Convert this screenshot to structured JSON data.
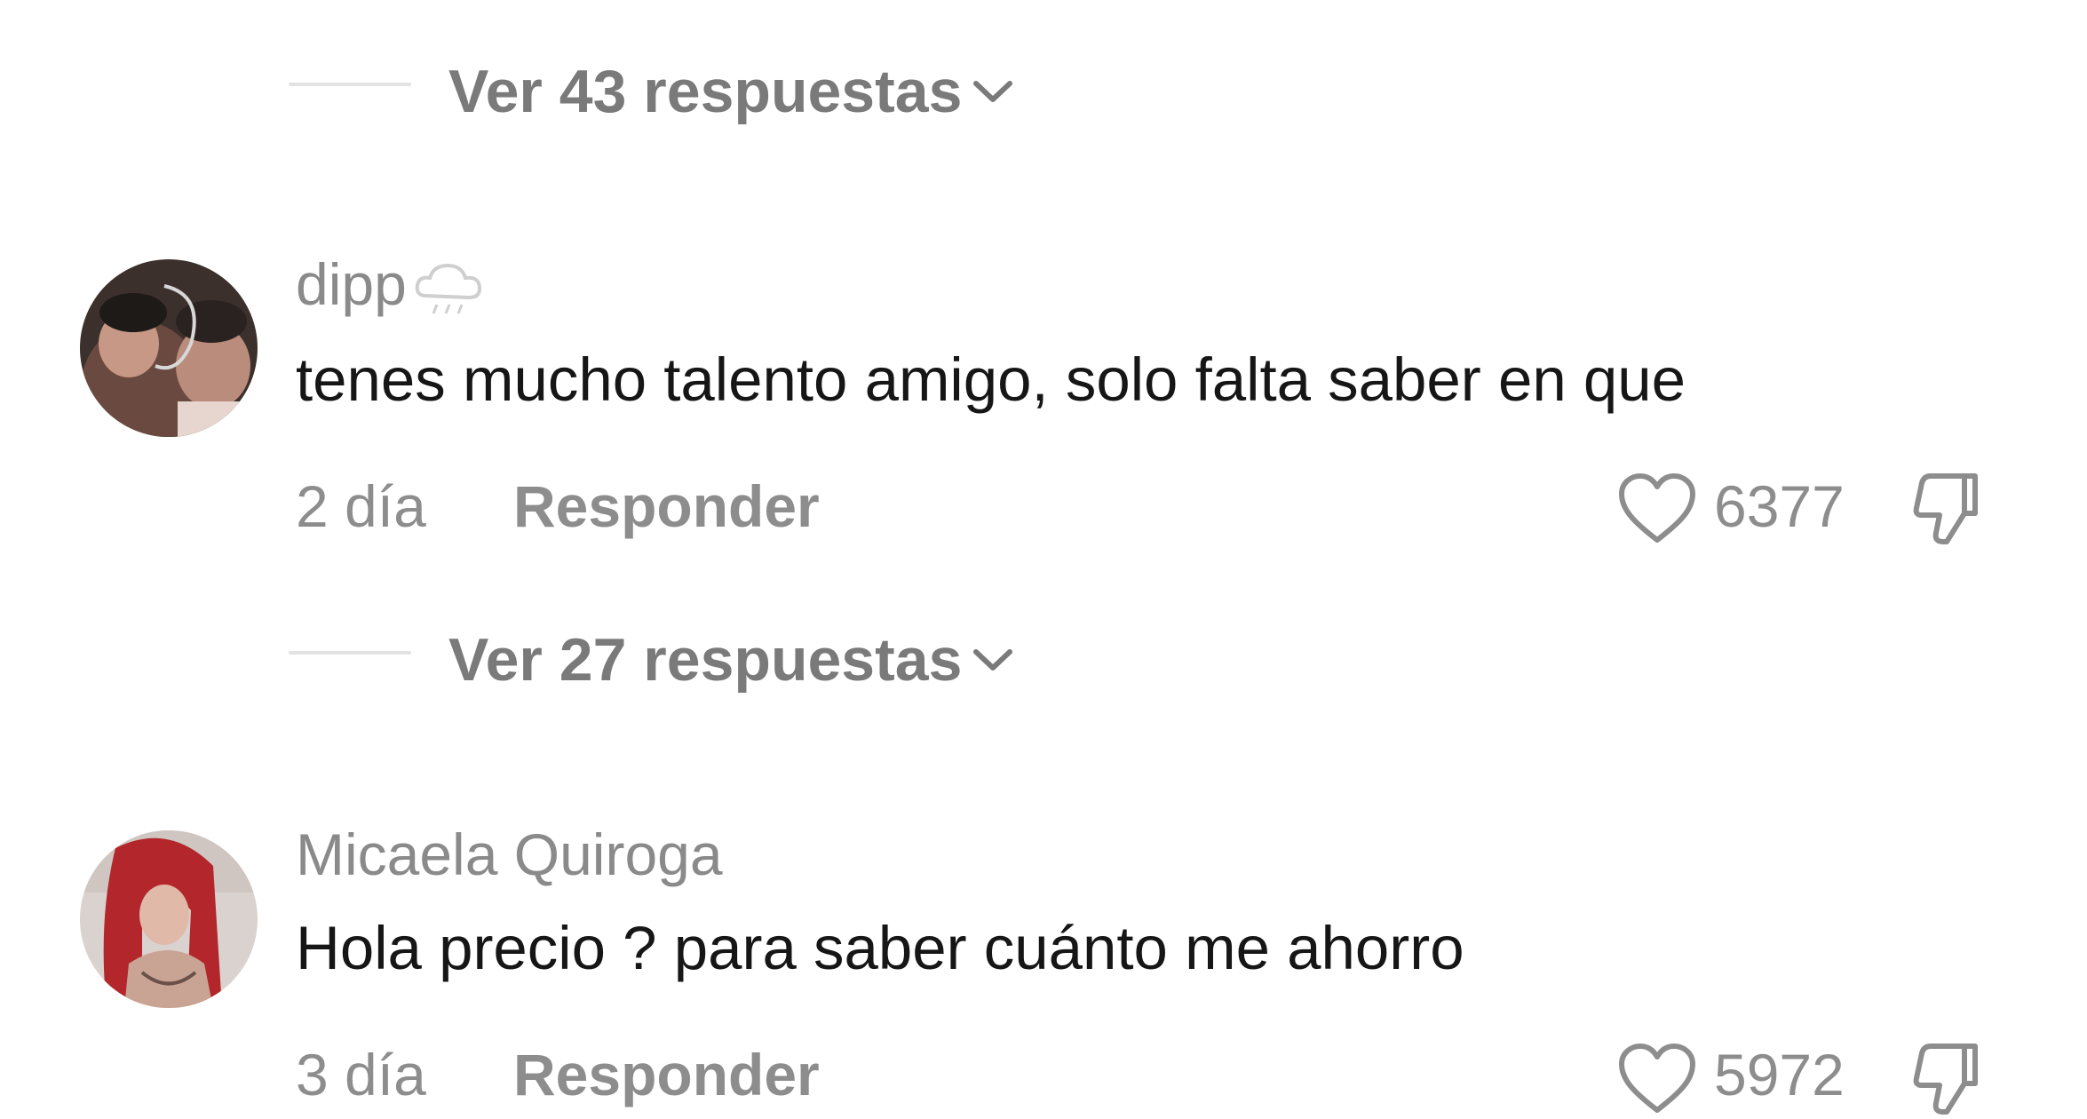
{
  "thread": {
    "replies_first": {
      "label": "Ver 43 respuestas"
    },
    "comments": [
      {
        "username": "dipp",
        "username_badge": "cloud-rain-icon",
        "text": "tenes mucho talento amigo, solo falta saber en que",
        "time": "2 día",
        "reply_label": "Responder",
        "likes": "6377",
        "replies_label": "Ver 27 respuestas"
      },
      {
        "username": "Micaela Quiroga",
        "text": "Hola precio ? para saber cuánto me ahorro",
        "time": "3 día",
        "reply_label": "Responder",
        "likes": "5972"
      }
    ]
  },
  "colors": {
    "text_primary": "#161616",
    "text_muted": "#8d8d8d",
    "divider": "#e3e3e3"
  }
}
